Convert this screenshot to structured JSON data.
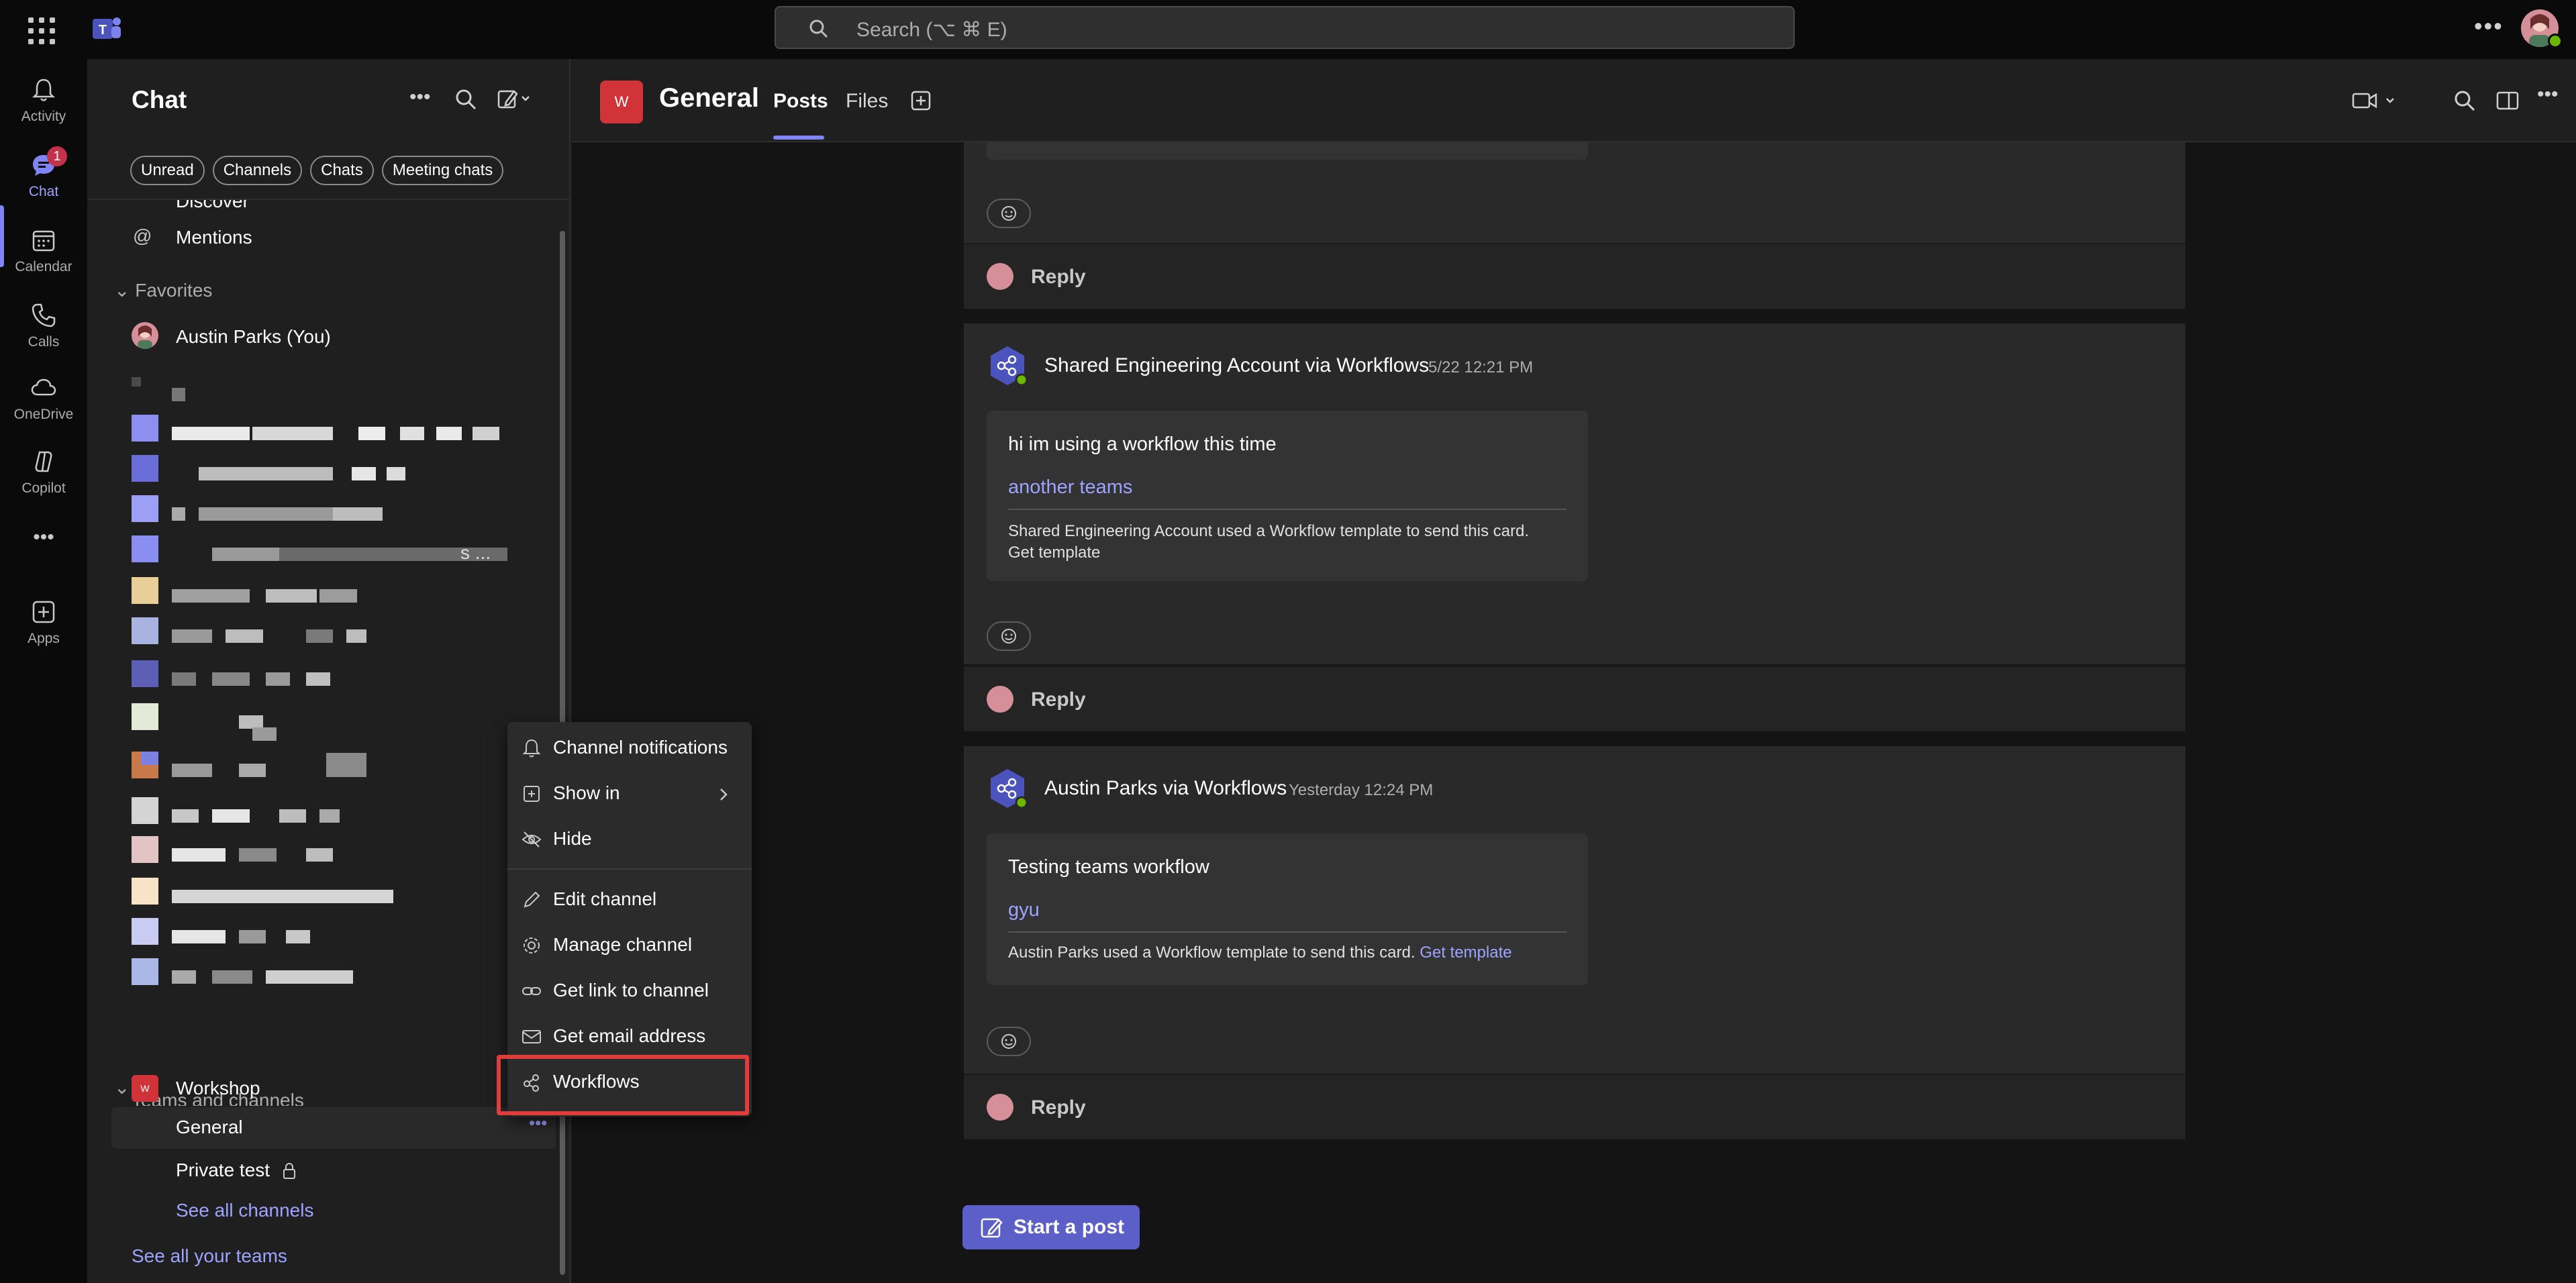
{
  "search": {
    "placeholder": "Search (⌥ ⌘ E)"
  },
  "rail": {
    "items": [
      {
        "label": "Activity",
        "icon": "bell-icon"
      },
      {
        "label": "Chat",
        "icon": "chat-icon",
        "badge": "1"
      },
      {
        "label": "Calendar",
        "icon": "calendar-icon"
      },
      {
        "label": "Calls",
        "icon": "phone-icon"
      },
      {
        "label": "OneDrive",
        "icon": "cloud-icon"
      },
      {
        "label": "Copilot",
        "icon": "copilot-icon"
      },
      {
        "label": "Apps",
        "icon": "apps-add-icon"
      }
    ],
    "more": "•••"
  },
  "chatpane": {
    "title": "Chat",
    "filters": [
      "Unread",
      "Channels",
      "Chats",
      "Meeting chats"
    ],
    "discover": "Discover",
    "mentions": "Mentions",
    "favorites_header": "Favorites",
    "favorite_user": "Austin Parks (You)",
    "truncated_tail": "s ...",
    "teams_header": "Teams and channels",
    "team_name": "Workshop",
    "team_initial": "W",
    "channels": [
      "General",
      "Private test"
    ],
    "see_all_channels": "See all channels",
    "see_all_teams": "See all your teams",
    "channel_more": "•••"
  },
  "header": {
    "team_initial": "W",
    "channel": "General",
    "tabs": [
      "Posts",
      "Files"
    ]
  },
  "posts": [
    {
      "reply": "Reply"
    },
    {
      "sender": "Shared Engineering Account via Workflows",
      "time": "5/22 12:21 PM",
      "body": "hi im using a workflow this time",
      "link": "another teams",
      "footer": "Shared Engineering Account used a Workflow template to send this card.",
      "footer_link": "Get template",
      "reply": "Reply"
    },
    {
      "sender": "Austin Parks via Workflows",
      "time": "Yesterday 12:24 PM",
      "body": "Testing teams workflow",
      "link": "gyu",
      "footer": "Austin Parks used a Workflow template to send this card.",
      "footer_link": "Get template",
      "reply": "Reply"
    }
  ],
  "start_post": "Start a post",
  "menu": {
    "items": [
      {
        "label": "Channel notifications",
        "icon": "bell-icon"
      },
      {
        "label": "Show in",
        "icon": "show-in-icon"
      },
      {
        "label": "Hide",
        "icon": "eye-off-icon"
      },
      {
        "label": "Edit channel",
        "icon": "pencil-icon"
      },
      {
        "label": "Manage channel",
        "icon": "gear-icon"
      },
      {
        "label": "Get link to channel",
        "icon": "link-icon"
      },
      {
        "label": "Get email address",
        "icon": "mail-icon"
      },
      {
        "label": "Workflows",
        "icon": "workflows-icon"
      }
    ]
  },
  "colors": {
    "accent": "#7f85f5",
    "brand_button": "#5b5fc7",
    "team_red": "#d13438",
    "highlight": "#e03c3c"
  }
}
